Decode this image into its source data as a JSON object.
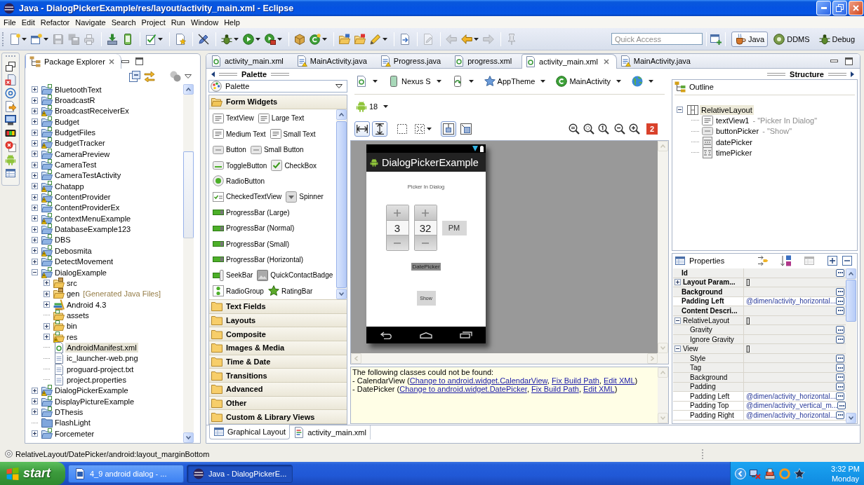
{
  "window": {
    "title": "Java - DialogPickerExample/res/layout/activity_main.xml - Eclipse"
  },
  "menu": [
    "File",
    "Edit",
    "Refactor",
    "Navigate",
    "Search",
    "Project",
    "Run",
    "Window",
    "Help"
  ],
  "toolbar": {
    "groups": [
      [
        {
          "kind": "new",
          "dropdown": true,
          "disabled": false
        },
        {
          "kind": "new-window",
          "dropdown": true,
          "disabled": false
        },
        {
          "kind": "save",
          "dropdown": false,
          "disabled": true
        },
        {
          "kind": "save-all",
          "dropdown": false,
          "disabled": true
        },
        {
          "kind": "print",
          "dropdown": false,
          "disabled": true
        }
      ],
      [
        {
          "kind": "download",
          "dropdown": false,
          "disabled": false
        },
        {
          "kind": "device",
          "dropdown": false,
          "disabled": false
        }
      ],
      [
        {
          "kind": "check",
          "dropdown": true,
          "disabled": false
        }
      ],
      [
        {
          "kind": "wizard",
          "dropdown": false,
          "disabled": false
        }
      ],
      [
        {
          "kind": "breakpoints",
          "dropdown": false,
          "disabled": false
        }
      ],
      [
        {
          "kind": "debug",
          "dropdown": true,
          "disabled": false
        },
        {
          "kind": "run",
          "dropdown": true,
          "disabled": false
        },
        {
          "kind": "tools",
          "dropdown": true,
          "disabled": false
        }
      ],
      [
        {
          "kind": "package",
          "dropdown": false,
          "disabled": false
        },
        {
          "kind": "class",
          "dropdown": true,
          "disabled": false
        }
      ],
      [
        {
          "kind": "open-type",
          "dropdown": false,
          "disabled": false
        },
        {
          "kind": "open-task",
          "dropdown": false,
          "disabled": false
        },
        {
          "kind": "search",
          "dropdown": true,
          "disabled": false
        }
      ],
      [
        {
          "kind": "annotation",
          "dropdown": false,
          "disabled": false
        }
      ],
      [
        {
          "kind": "last-edit",
          "dropdown": false,
          "disabled": true
        }
      ],
      [
        {
          "kind": "back",
          "dropdown": false,
          "disabled": true
        },
        {
          "kind": "back",
          "dropdown": true,
          "disabled": false
        },
        {
          "kind": "forward",
          "dropdown": false,
          "disabled": true
        }
      ],
      [
        {
          "kind": "pin",
          "dropdown": false,
          "disabled": true
        }
      ]
    ]
  },
  "quick_access": {
    "placeholder": "Quick Access"
  },
  "perspectives": [
    {
      "label": "Java",
      "kind": "java",
      "selected": true
    },
    {
      "label": "DDMS",
      "kind": "ddms",
      "selected": false
    },
    {
      "label": "Debug",
      "kind": "debug",
      "selected": false
    }
  ],
  "package_explorer": {
    "title": "Package Explorer",
    "tree": [
      {
        "label": "BluetoothText",
        "kind": "project",
        "warning": false,
        "expanded": false,
        "selected": false
      },
      {
        "label": "BroadcastR",
        "kind": "project",
        "warning": false,
        "expanded": false,
        "selected": false
      },
      {
        "label": "BroadcastReceiverEx",
        "kind": "project",
        "warning": true,
        "expanded": false,
        "selected": false
      },
      {
        "label": "Budget",
        "kind": "project",
        "warning": false,
        "expanded": false,
        "selected": false
      },
      {
        "label": "BudgetFiles",
        "kind": "project",
        "warning": false,
        "expanded": false,
        "selected": false
      },
      {
        "label": "BudgetTracker",
        "kind": "project",
        "warning": true,
        "expanded": false,
        "selected": false
      },
      {
        "label": "CameraPreview",
        "kind": "project",
        "warning": false,
        "expanded": false,
        "selected": false
      },
      {
        "label": "CameraTest",
        "kind": "project",
        "warning": false,
        "expanded": false,
        "selected": false
      },
      {
        "label": "CameraTestActivity",
        "kind": "project",
        "warning": false,
        "expanded": false,
        "selected": false
      },
      {
        "label": "Chatapp",
        "kind": "project",
        "warning": true,
        "expanded": false,
        "selected": false
      },
      {
        "label": "ContentProvider",
        "kind": "project",
        "warning": true,
        "expanded": false,
        "selected": false
      },
      {
        "label": "ContentProviderEx",
        "kind": "project",
        "warning": false,
        "expanded": false,
        "selected": false
      },
      {
        "label": "ContextMenuExample",
        "kind": "project",
        "warning": true,
        "expanded": false,
        "selected": false
      },
      {
        "label": "DatabaseExample123",
        "kind": "project",
        "warning": false,
        "expanded": false,
        "selected": false
      },
      {
        "label": "DBS",
        "kind": "project",
        "warning": false,
        "expanded": false,
        "selected": false
      },
      {
        "label": "Debosmita",
        "kind": "project",
        "warning": true,
        "expanded": false,
        "selected": false
      },
      {
        "label": "DetectMovement",
        "kind": "project",
        "warning": false,
        "expanded": false,
        "selected": false
      },
      {
        "label": "DialogExample",
        "kind": "project",
        "warning": true,
        "expanded": true,
        "selected": false,
        "children": [
          {
            "label": "src",
            "kind": "source-folder",
            "warning": false,
            "expanded": false,
            "selected": false
          },
          {
            "label": "gen",
            "decoration": "[Generated Java Files]",
            "kind": "source-folder",
            "warning": false,
            "expanded": false,
            "selected": false
          },
          {
            "label": "Android 4.3",
            "kind": "library",
            "expanded": false,
            "selected": false
          },
          {
            "label": "assets",
            "kind": "folder",
            "warning": false,
            "selected": false
          },
          {
            "label": "bin",
            "kind": "folder",
            "warning": false,
            "expanded": false,
            "selected": false
          },
          {
            "label": "res",
            "kind": "folder",
            "warning": true,
            "expanded": false,
            "selected": false
          },
          {
            "label": "AndroidManifest.xml",
            "kind": "manifest",
            "selected": true
          },
          {
            "label": "ic_launcher-web.png",
            "kind": "file",
            "selected": false
          },
          {
            "label": "proguard-project.txt",
            "kind": "file",
            "selected": false
          },
          {
            "label": "project.properties",
            "kind": "file",
            "selected": false
          }
        ]
      },
      {
        "label": "DialogPickerExample",
        "kind": "project",
        "warning": true,
        "expanded": false,
        "selected": false
      },
      {
        "label": "DisplayPictureExample",
        "kind": "project",
        "warning": false,
        "expanded": false,
        "selected": false
      },
      {
        "label": "DThesis",
        "kind": "project",
        "warning": false,
        "expanded": false,
        "selected": false
      },
      {
        "label": "FlashLight",
        "kind": "closed-project",
        "selected": false
      },
      {
        "label": "Forcemeter",
        "kind": "project",
        "warning": false,
        "expanded": false,
        "selected": false
      }
    ]
  },
  "editor_tabs": [
    {
      "label": "activity_main.xml",
      "kind": "xml",
      "selected": false
    },
    {
      "label": "MainActivity.java",
      "kind": "java",
      "selected": false
    },
    {
      "label": "Progress.java",
      "kind": "java",
      "selected": false
    },
    {
      "label": "progress.xml",
      "kind": "xml",
      "selected": false
    },
    {
      "label": "activity_main.xml",
      "kind": "xml",
      "selected": true
    },
    {
      "label": "MainActivity.java",
      "kind": "java",
      "selected": false
    }
  ],
  "palette": {
    "title": "Palette",
    "filter": "Palette",
    "groups": [
      {
        "label": "Form Widgets",
        "expanded": true,
        "rows": [
          [
            {
              "label": "TextView",
              "kind": "text"
            },
            {
              "label": "Large Text",
              "kind": "text"
            }
          ],
          [
            {
              "label": "Medium Text",
              "kind": "text"
            },
            {
              "label": "Small Text",
              "kind": "text"
            }
          ],
          [
            {
              "label": "Button",
              "kind": "button"
            },
            {
              "label": "Small Button",
              "kind": "button"
            }
          ],
          [
            {
              "label": "ToggleButton",
              "kind": "toggle"
            },
            {
              "label": "CheckBox",
              "kind": "checkbox"
            }
          ],
          [
            {
              "label": "RadioButton",
              "kind": "radio"
            }
          ],
          [
            {
              "label": "CheckedTextView",
              "kind": "checked-text"
            },
            {
              "label": "Spinner",
              "kind": "spinner"
            }
          ],
          [
            {
              "label": "ProgressBar (Large)",
              "kind": "progress"
            }
          ],
          [
            {
              "label": "ProgressBar (Normal)",
              "kind": "progress"
            }
          ],
          [
            {
              "label": "ProgressBar (Small)",
              "kind": "progress"
            }
          ],
          [
            {
              "label": "ProgressBar (Horizontal)",
              "kind": "progress"
            }
          ],
          [
            {
              "label": "SeekBar",
              "kind": "seekbar"
            },
            {
              "label": "QuickContactBadge",
              "kind": "badge"
            }
          ],
          [
            {
              "label": "RadioGroup",
              "kind": "radio-group"
            },
            {
              "label": "RatingBar",
              "kind": "rating"
            }
          ]
        ]
      },
      {
        "label": "Text Fields",
        "expanded": false
      },
      {
        "label": "Layouts",
        "expanded": false
      },
      {
        "label": "Composite",
        "expanded": false
      },
      {
        "label": "Images & Media",
        "expanded": false
      },
      {
        "label": "Time & Date",
        "expanded": false
      },
      {
        "label": "Transitions",
        "expanded": false
      },
      {
        "label": "Advanced",
        "expanded": false
      },
      {
        "label": "Other",
        "expanded": false
      },
      {
        "label": "Custom & Library Views",
        "expanded": false
      }
    ]
  },
  "designer": {
    "config": {
      "device": "Nexus S",
      "theme": "AppTheme",
      "activity": "MainActivity",
      "api_level": "18"
    },
    "actions": [
      [
        {
          "kind": "fit-width",
          "selected": true,
          "dropdown": false
        },
        {
          "kind": "fit-height",
          "selected": true,
          "dropdown": false
        }
      ],
      [
        {
          "kind": "select",
          "selected": false,
          "dropdown": false
        },
        {
          "kind": "expand",
          "selected": false,
          "dropdown": true
        }
      ],
      [
        {
          "kind": "margins",
          "selected": true,
          "dropdown": false
        },
        {
          "kind": "resize",
          "selected": false,
          "dropdown": false
        }
      ]
    ],
    "error_count": "2",
    "preview": {
      "app_title": "DialogPickerExample",
      "heading": "Picker In Dialog",
      "time_picker": {
        "hour": "3",
        "minute": "32",
        "am_pm": "PM"
      },
      "date_picker": "DatePicker",
      "button": "Show"
    },
    "errors": {
      "heading": "The following classes could not be found:",
      "lines": [
        [
          {
            "text": "- CalendarView (",
            "kind": "text"
          },
          {
            "text": "Change to android.widget.CalendarView",
            "kind": "link"
          },
          {
            "text": ", ",
            "kind": "text"
          },
          {
            "text": "Fix Build Path",
            "kind": "link"
          },
          {
            "text": ", ",
            "kind": "text"
          },
          {
            "text": "Edit XML",
            "kind": "link"
          },
          {
            "text": ")",
            "kind": "text"
          }
        ],
        [
          {
            "text": "- DatePicker (",
            "kind": "text"
          },
          {
            "text": "Change to android.widget.DatePicker",
            "kind": "link"
          },
          {
            "text": ", ",
            "kind": "text"
          },
          {
            "text": "Fix Build Path",
            "kind": "link"
          },
          {
            "text": ", ",
            "kind": "text"
          },
          {
            "text": "Edit XML",
            "kind": "link"
          },
          {
            "text": ")",
            "kind": "text"
          }
        ]
      ]
    }
  },
  "structure": {
    "title": "Structure",
    "outline": {
      "title": "Outline",
      "tree": [
        {
          "label": "RelativeLayout",
          "kind": "layout",
          "selected": true,
          "expanded": true,
          "children": [
            {
              "label": "textView1",
              "detail": "- \"Picker In Dialog\"",
              "kind": "text",
              "selected": false
            },
            {
              "label": "buttonPicker",
              "detail": "- \"Show\"",
              "kind": "button",
              "selected": false
            },
            {
              "label": "datePicker",
              "kind": "date-picker",
              "selected": false
            },
            {
              "label": "timePicker",
              "kind": "time-picker",
              "selected": false
            }
          ]
        }
      ]
    },
    "properties": {
      "title": "Properties",
      "rows": [
        {
          "name": "Id",
          "kind": "property"
        },
        {
          "name": "Layout Param...",
          "kind": "property",
          "value": "[]",
          "expanded": false
        },
        {
          "name": "Background",
          "kind": "property"
        },
        {
          "name": "Padding Left",
          "kind": "property",
          "value": "@dimen/activity_horizontal..."
        },
        {
          "name": "Content Descri...",
          "kind": "property"
        },
        {
          "name": "RelativeLayout",
          "kind": "category",
          "value": "[]",
          "expanded": true,
          "children": [
            {
              "name": "Gravity",
              "kind": "property"
            },
            {
              "name": "Ignore Gravity",
              "kind": "property"
            }
          ]
        },
        {
          "name": "View",
          "kind": "category",
          "value": "[]",
          "expanded": true,
          "children": [
            {
              "name": "Style",
              "kind": "property"
            },
            {
              "name": "Tag",
              "kind": "property"
            },
            {
              "name": "Background",
              "kind": "property"
            },
            {
              "name": "Padding",
              "kind": "property"
            },
            {
              "name": "Padding Left",
              "kind": "property",
              "value": "@dimen/activity_horizontal..."
            },
            {
              "name": "Padding Top",
              "kind": "property",
              "value": "@dimen/activity_vertical_m..."
            },
            {
              "name": "Padding Right",
              "kind": "property",
              "value": "@dimen/activity_horizontal..."
            }
          ]
        }
      ]
    }
  },
  "editor_bottom_tabs": [
    {
      "label": "Graphical Layout",
      "kind": "layout",
      "selected": true
    },
    {
      "label": "activity_main.xml",
      "kind": "xml",
      "selected": false
    }
  ],
  "status_bar": {
    "text": "RelativeLayout/DatePicker/android:layout_marginBottom"
  },
  "taskbar": {
    "start": "start",
    "tasks": [
      {
        "label": "4_9 android dialog - ...",
        "kind": "document",
        "selected": false
      },
      {
        "label": "Java - DialogPickerE...",
        "kind": "app",
        "selected": true
      }
    ],
    "clock": {
      "time": "3:32 PM",
      "day": "Monday"
    }
  }
}
